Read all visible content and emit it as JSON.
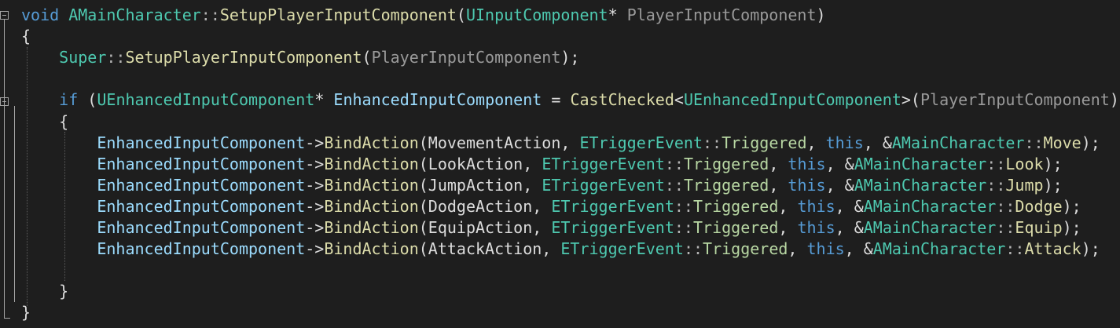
{
  "editor": {
    "theme_colors": {
      "background": "#1e1e1e",
      "keyword": "#569cd6",
      "type": "#4ec9b0",
      "function": "#dcdcaa",
      "parameter": "#9a9a9a",
      "variable": "#9cdcfe",
      "enum_member": "#b8d7a3",
      "plain": "#dcdcdc"
    },
    "lines": [
      {
        "tokens": [
          {
            "t": "void",
            "c": "kw"
          },
          {
            "t": " ",
            "c": "plain"
          },
          {
            "t": "AMainCharacter",
            "c": "type"
          },
          {
            "t": "::",
            "c": "punc"
          },
          {
            "t": "SetupPlayerInputComponent",
            "c": "fn"
          },
          {
            "t": "(",
            "c": "plain"
          },
          {
            "t": "UInputComponent",
            "c": "type"
          },
          {
            "t": "* ",
            "c": "plain"
          },
          {
            "t": "PlayerInputComponent",
            "c": "param"
          },
          {
            "t": ")",
            "c": "plain"
          }
        ]
      },
      {
        "tokens": [
          {
            "t": "{",
            "c": "plain"
          }
        ]
      },
      {
        "tokens": [
          {
            "t": "    ",
            "c": "plain"
          },
          {
            "t": "Super",
            "c": "type"
          },
          {
            "t": "::",
            "c": "punc"
          },
          {
            "t": "SetupPlayerInputComponent",
            "c": "fn"
          },
          {
            "t": "(",
            "c": "plain"
          },
          {
            "t": "PlayerInputComponent",
            "c": "param"
          },
          {
            "t": ");",
            "c": "plain"
          }
        ]
      },
      {
        "tokens": [
          {
            "t": "",
            "c": "plain"
          }
        ]
      },
      {
        "tokens": [
          {
            "t": "    ",
            "c": "plain"
          },
          {
            "t": "if",
            "c": "kw"
          },
          {
            "t": " (",
            "c": "plain"
          },
          {
            "t": "UEnhancedInputComponent",
            "c": "type"
          },
          {
            "t": "* ",
            "c": "plain"
          },
          {
            "t": "EnhancedInputComponent",
            "c": "var"
          },
          {
            "t": " = ",
            "c": "plain"
          },
          {
            "t": "CastChecked",
            "c": "fn"
          },
          {
            "t": "<",
            "c": "plain"
          },
          {
            "t": "UEnhancedInputComponent",
            "c": "type"
          },
          {
            "t": ">(",
            "c": "plain"
          },
          {
            "t": "PlayerInputComponent",
            "c": "param"
          },
          {
            "t": "))",
            "c": "plain"
          }
        ]
      },
      {
        "tokens": [
          {
            "t": "    {",
            "c": "plain"
          }
        ]
      },
      {
        "tokens": [
          {
            "t": "        ",
            "c": "plain"
          },
          {
            "t": "EnhancedInputComponent",
            "c": "var"
          },
          {
            "t": "->",
            "c": "plain"
          },
          {
            "t": "BindAction",
            "c": "fn"
          },
          {
            "t": "(",
            "c": "plain"
          },
          {
            "t": "MovementAction",
            "c": "plain"
          },
          {
            "t": ", ",
            "c": "plain"
          },
          {
            "t": "ETriggerEvent",
            "c": "type"
          },
          {
            "t": "::",
            "c": "punc"
          },
          {
            "t": "Triggered",
            "c": "enum"
          },
          {
            "t": ", ",
            "c": "plain"
          },
          {
            "t": "this",
            "c": "kw"
          },
          {
            "t": ", &",
            "c": "plain"
          },
          {
            "t": "AMainCharacter",
            "c": "type"
          },
          {
            "t": "::",
            "c": "punc"
          },
          {
            "t": "Move",
            "c": "fn"
          },
          {
            "t": ");",
            "c": "plain"
          }
        ]
      },
      {
        "tokens": [
          {
            "t": "        ",
            "c": "plain"
          },
          {
            "t": "EnhancedInputComponent",
            "c": "var"
          },
          {
            "t": "->",
            "c": "plain"
          },
          {
            "t": "BindAction",
            "c": "fn"
          },
          {
            "t": "(",
            "c": "plain"
          },
          {
            "t": "LookAction",
            "c": "plain"
          },
          {
            "t": ", ",
            "c": "plain"
          },
          {
            "t": "ETriggerEvent",
            "c": "type"
          },
          {
            "t": "::",
            "c": "punc"
          },
          {
            "t": "Triggered",
            "c": "enum"
          },
          {
            "t": ", ",
            "c": "plain"
          },
          {
            "t": "this",
            "c": "kw"
          },
          {
            "t": ", &",
            "c": "plain"
          },
          {
            "t": "AMainCharacter",
            "c": "type"
          },
          {
            "t": "::",
            "c": "punc"
          },
          {
            "t": "Look",
            "c": "fn"
          },
          {
            "t": ");",
            "c": "plain"
          }
        ]
      },
      {
        "tokens": [
          {
            "t": "        ",
            "c": "plain"
          },
          {
            "t": "EnhancedInputComponent",
            "c": "var"
          },
          {
            "t": "->",
            "c": "plain"
          },
          {
            "t": "BindAction",
            "c": "fn"
          },
          {
            "t": "(",
            "c": "plain"
          },
          {
            "t": "JumpAction",
            "c": "plain"
          },
          {
            "t": ", ",
            "c": "plain"
          },
          {
            "t": "ETriggerEvent",
            "c": "type"
          },
          {
            "t": "::",
            "c": "punc"
          },
          {
            "t": "Triggered",
            "c": "enum"
          },
          {
            "t": ", ",
            "c": "plain"
          },
          {
            "t": "this",
            "c": "kw"
          },
          {
            "t": ", &",
            "c": "plain"
          },
          {
            "t": "AMainCharacter",
            "c": "type"
          },
          {
            "t": "::",
            "c": "punc"
          },
          {
            "t": "Jump",
            "c": "fn"
          },
          {
            "t": ");",
            "c": "plain"
          }
        ]
      },
      {
        "tokens": [
          {
            "t": "        ",
            "c": "plain"
          },
          {
            "t": "EnhancedInputComponent",
            "c": "var"
          },
          {
            "t": "->",
            "c": "plain"
          },
          {
            "t": "BindAction",
            "c": "fn"
          },
          {
            "t": "(",
            "c": "plain"
          },
          {
            "t": "DodgeAction",
            "c": "plain"
          },
          {
            "t": ", ",
            "c": "plain"
          },
          {
            "t": "ETriggerEvent",
            "c": "type"
          },
          {
            "t": "::",
            "c": "punc"
          },
          {
            "t": "Triggered",
            "c": "enum"
          },
          {
            "t": ", ",
            "c": "plain"
          },
          {
            "t": "this",
            "c": "kw"
          },
          {
            "t": ", &",
            "c": "plain"
          },
          {
            "t": "AMainCharacter",
            "c": "type"
          },
          {
            "t": "::",
            "c": "punc"
          },
          {
            "t": "Dodge",
            "c": "fn"
          },
          {
            "t": ");",
            "c": "plain"
          }
        ]
      },
      {
        "tokens": [
          {
            "t": "        ",
            "c": "plain"
          },
          {
            "t": "EnhancedInputComponent",
            "c": "var"
          },
          {
            "t": "->",
            "c": "plain"
          },
          {
            "t": "BindAction",
            "c": "fn"
          },
          {
            "t": "(",
            "c": "plain"
          },
          {
            "t": "EquipAction",
            "c": "plain"
          },
          {
            "t": ", ",
            "c": "plain"
          },
          {
            "t": "ETriggerEvent",
            "c": "type"
          },
          {
            "t": "::",
            "c": "punc"
          },
          {
            "t": "Triggered",
            "c": "enum"
          },
          {
            "t": ", ",
            "c": "plain"
          },
          {
            "t": "this",
            "c": "kw"
          },
          {
            "t": ", &",
            "c": "plain"
          },
          {
            "t": "AMainCharacter",
            "c": "type"
          },
          {
            "t": "::",
            "c": "punc"
          },
          {
            "t": "Equip",
            "c": "fn"
          },
          {
            "t": ");",
            "c": "plain"
          }
        ]
      },
      {
        "tokens": [
          {
            "t": "        ",
            "c": "plain"
          },
          {
            "t": "EnhancedInputComponent",
            "c": "var"
          },
          {
            "t": "->",
            "c": "plain"
          },
          {
            "t": "BindAction",
            "c": "fn"
          },
          {
            "t": "(",
            "c": "plain"
          },
          {
            "t": "AttackAction",
            "c": "plain"
          },
          {
            "t": ", ",
            "c": "plain"
          },
          {
            "t": "ETriggerEvent",
            "c": "type"
          },
          {
            "t": "::",
            "c": "punc"
          },
          {
            "t": "Triggered",
            "c": "enum"
          },
          {
            "t": ", ",
            "c": "plain"
          },
          {
            "t": "this",
            "c": "kw"
          },
          {
            "t": ", &",
            "c": "plain"
          },
          {
            "t": "AMainCharacter",
            "c": "type"
          },
          {
            "t": "::",
            "c": "punc"
          },
          {
            "t": "Attack",
            "c": "fn"
          },
          {
            "t": ");",
            "c": "plain"
          }
        ]
      },
      {
        "tokens": [
          {
            "t": "",
            "c": "plain"
          }
        ]
      },
      {
        "tokens": [
          {
            "t": "    }",
            "c": "plain"
          }
        ]
      },
      {
        "tokens": [
          {
            "t": "}",
            "c": "plain"
          }
        ]
      }
    ]
  }
}
